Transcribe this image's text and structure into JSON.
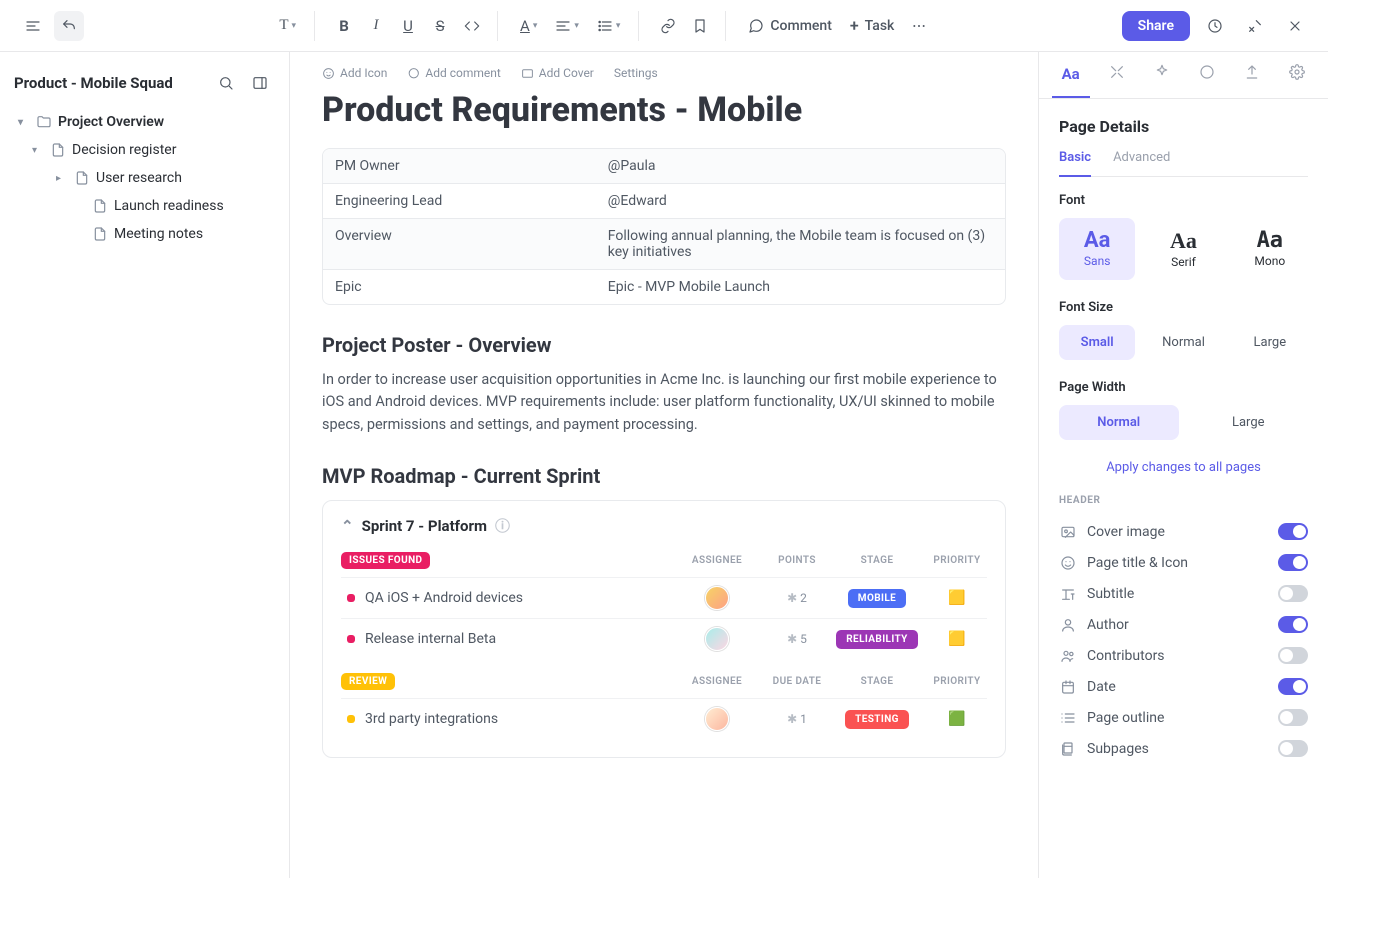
{
  "toolbar": {
    "comment_label": "Comment",
    "task_label": "Task",
    "share_label": "Share"
  },
  "sidebar": {
    "title": "Product - Mobile Squad",
    "tree": [
      {
        "label": "Project Overview"
      },
      {
        "label": "Decision register"
      },
      {
        "label": "User research"
      },
      {
        "label": "Launch readiness"
      },
      {
        "label": "Meeting notes"
      }
    ]
  },
  "doc": {
    "actions": {
      "add_icon": "Add Icon",
      "add_comment": "Add comment",
      "add_cover": "Add Cover",
      "settings": "Settings"
    },
    "title": "Product Requirements - Mobile",
    "meta": [
      {
        "k": "PM Owner",
        "v": "@Paula"
      },
      {
        "k": "Engineering Lead",
        "v": "@Edward"
      },
      {
        "k": "Overview",
        "v": "Following annual planning, the Mobile team is focused on (3) key initiatives"
      },
      {
        "k": "Epic",
        "v": "Epic - MVP Mobile Launch"
      }
    ],
    "poster_heading": "Project Poster - Overview",
    "poster_body": "In order to increase user acquisition opportunities in Acme Inc. is launching our first mobile experience to iOS and Android devices. MVP requirements include: user platform functionality, UX/UI skinned to mobile specs, permissions and settings, and payment processing.",
    "roadmap_heading": "MVP Roadmap - Current Sprint",
    "sprint_title": "Sprint  7 - Platform",
    "sections": [
      {
        "badge": "ISSUES FOUND",
        "badge_class": "pink",
        "cols": [
          "ASSIGNEE",
          "POINTS",
          "STAGE",
          "PRIORITY"
        ],
        "tasks": [
          {
            "dot": "pink",
            "name": "QA iOS + Android devices",
            "points": "2",
            "stage": "MOBILE",
            "stage_class": "blue",
            "flag": "🟨",
            "avatar": "a"
          },
          {
            "dot": "pink",
            "name": "Release internal Beta",
            "points": "5",
            "stage": "RELIABILITY",
            "stage_class": "purple",
            "flag": "🟨",
            "avatar": "b"
          }
        ]
      },
      {
        "badge": "REVIEW",
        "badge_class": "yellow",
        "cols": [
          "ASSIGNEE",
          "DUE DATE",
          "STAGE",
          "PRIORITY"
        ],
        "tasks": [
          {
            "dot": "yellow",
            "name": "3rd party integrations",
            "points": "1",
            "stage": "TESTING",
            "stage_class": "red",
            "flag": "🟩",
            "avatar": "c"
          }
        ]
      }
    ]
  },
  "rpanel": {
    "title": "Page Details",
    "tabs": {
      "basic": "Basic",
      "advanced": "Advanced"
    },
    "font_label": "Font",
    "font_opts": {
      "sans": "Sans",
      "serif": "Serif",
      "mono": "Mono"
    },
    "size_label": "Font Size",
    "size_opts": {
      "small": "Small",
      "normal": "Normal",
      "large": "Large"
    },
    "width_label": "Page Width",
    "width_opts": {
      "normal": "Normal",
      "large": "Large"
    },
    "apply_all": "Apply changes to all pages",
    "header_section": "HEADER",
    "toggles": [
      {
        "label": "Cover image",
        "on": true,
        "icon": "image"
      },
      {
        "label": "Page title & Icon",
        "on": true,
        "icon": "smile"
      },
      {
        "label": "Subtitle",
        "on": false,
        "icon": "type"
      },
      {
        "label": "Author",
        "on": true,
        "icon": "user"
      },
      {
        "label": "Contributors",
        "on": false,
        "icon": "users"
      },
      {
        "label": "Date",
        "on": true,
        "icon": "calendar"
      },
      {
        "label": "Page outline",
        "on": false,
        "icon": "list"
      },
      {
        "label": "Subpages",
        "on": false,
        "icon": "pages"
      }
    ]
  }
}
